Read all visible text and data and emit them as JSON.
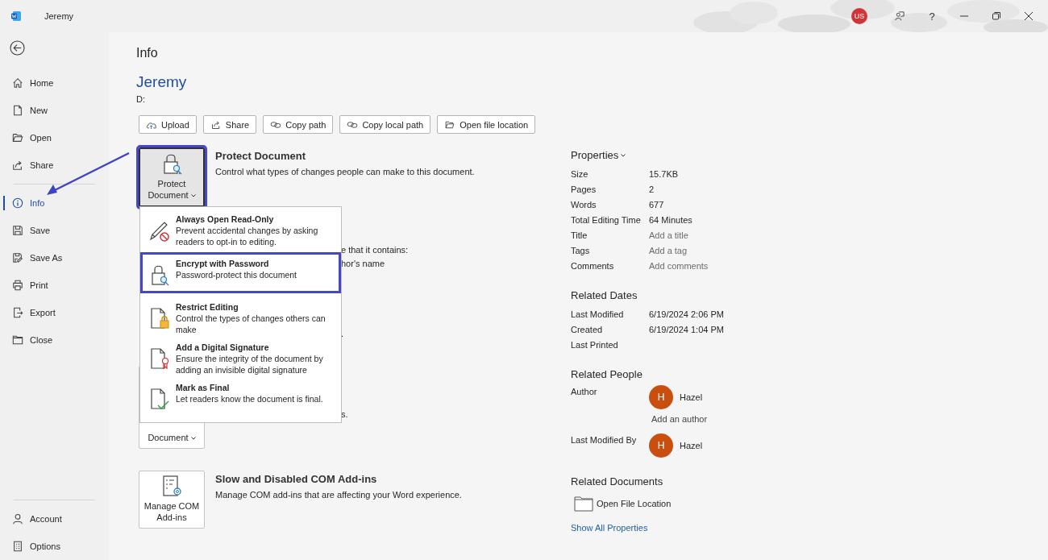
{
  "window": {
    "title": "Jeremy",
    "account_badge": "US",
    "help": "?"
  },
  "sidebar": {
    "top_items": [
      {
        "label": "Home",
        "kind": "home",
        "selected": false
      },
      {
        "label": "New",
        "kind": "new",
        "selected": false
      },
      {
        "label": "Open",
        "kind": "open",
        "selected": false
      },
      {
        "label": "Share",
        "kind": "share",
        "selected": false
      }
    ],
    "middle_items": [
      {
        "label": "Info",
        "kind": "info",
        "selected": true
      },
      {
        "label": "Save",
        "kind": "save",
        "selected": false
      },
      {
        "label": "Save As",
        "kind": "saveas",
        "selected": false
      },
      {
        "label": "Print",
        "kind": "print",
        "selected": false
      },
      {
        "label": "Export",
        "kind": "export",
        "selected": false
      },
      {
        "label": "Close",
        "kind": "close",
        "selected": false
      }
    ],
    "bottom_items": [
      {
        "label": "Account",
        "kind": "account",
        "selected": false
      },
      {
        "label": "Options",
        "kind": "options",
        "selected": false
      }
    ]
  },
  "page": {
    "heading": "Info",
    "document_name": "Jeremy",
    "location": "D:",
    "actions": [
      {
        "label": "Upload",
        "kind": "upload"
      },
      {
        "label": "Share",
        "kind": "share"
      },
      {
        "label": "Copy path",
        "kind": "link"
      },
      {
        "label": "Copy local path",
        "kind": "link"
      },
      {
        "label": "Open file location",
        "kind": "open"
      }
    ],
    "sections": [
      {
        "kind": "protect",
        "button_lines": [
          "Protect",
          "Document"
        ],
        "highlighted": true,
        "title": "Protect Document",
        "description": "Control what types of changes people can make to this document."
      },
      {
        "kind": "inspect",
        "fragments": [
          "e that it contains:",
          "hor's name",
          "."
        ]
      },
      {
        "kind": "manage",
        "button_lines": [
          "Document"
        ],
        "fragments": [
          "s."
        ]
      },
      {
        "kind": "addins",
        "button_lines": [
          "Manage COM",
          "Add-ins"
        ],
        "highlighted": false,
        "title": "Slow and Disabled COM Add-ins",
        "description": "Manage COM add-ins that are affecting your Word experience."
      }
    ],
    "protect_menu": [
      {
        "kind": "pencil",
        "title": "Always Open Read-Only",
        "description": "Prevent accidental changes by asking readers to opt-in to editing.",
        "highlighted": false
      },
      {
        "kind": "lock",
        "title": "Encrypt with Password",
        "description": "Password-protect this document",
        "highlighted": true
      },
      {
        "kind": "restrict",
        "title": "Restrict Editing",
        "description": "Control the types of changes others can make",
        "highlighted": false
      },
      {
        "kind": "signature",
        "title": "Add a Digital Signature",
        "description": "Ensure the integrity of the document by adding an invisible digital signature",
        "highlighted": false
      },
      {
        "kind": "final",
        "title": "Mark as Final",
        "description": "Let readers know the document is final.",
        "highlighted": false
      }
    ]
  },
  "properties": {
    "heading": "Properties",
    "rows": [
      {
        "label": "Size",
        "value": "15.7KB"
      },
      {
        "label": "Pages",
        "value": "2"
      },
      {
        "label": "Words",
        "value": "677"
      },
      {
        "label": "Total Editing Time",
        "value": "64 Minutes"
      },
      {
        "label": "Title",
        "placeholder": "Add a title"
      },
      {
        "label": "Tags",
        "placeholder": "Add a tag"
      },
      {
        "label": "Comments",
        "placeholder": "Add comments"
      }
    ],
    "related_dates": {
      "heading": "Related Dates",
      "rows": [
        {
          "label": "Last Modified",
          "value": "6/19/2024 2:06 PM"
        },
        {
          "label": "Created",
          "value": "6/19/2024 1:04 PM"
        },
        {
          "label": "Last Printed"
        }
      ]
    },
    "related_people": {
      "heading": "Related People",
      "rows": [
        {
          "label": "Author",
          "initial": "H",
          "name": "Hazel",
          "add_link": "Add an author"
        },
        {
          "label": "Last Modified By",
          "initial": "H",
          "name": "Hazel"
        }
      ]
    },
    "related_documents": {
      "heading": "Related Documents",
      "items": [
        "Open File Location"
      ]
    },
    "show_all": "Show All Properties"
  }
}
